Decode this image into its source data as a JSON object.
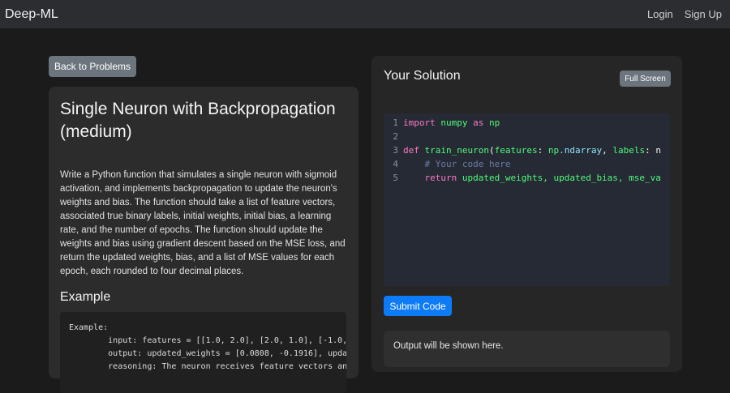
{
  "navbar": {
    "brand": "Deep-ML",
    "login": "Login",
    "signup": "Sign Up"
  },
  "left": {
    "back_button": "Back to Problems",
    "title": "Single Neuron with Backpropagation (medium)",
    "description": "Write a Python function that simulates a single neuron with sigmoid activation, and implements backpropagation to update the neuron's weights and bias. The function should take a list of feature vectors, associated true binary labels, initial weights, initial bias, a learning rate, and the number of epochs. The function should update the weights and bias using gradient descent based on the MSE loss, and return the updated weights, bias, and a list of MSE values for each epoch, each rounded to four decimal places.",
    "example_heading": "Example",
    "example_lines": [
      "Example:",
      "        input: features = [[1.0, 2.0], [2.0, 1.0], [-1.0,",
      "        output: updated_weights = [0.0808, -0.1916], upda",
      "        reasoning: The neuron receives feature vectors an"
    ]
  },
  "right": {
    "title": "Your Solution",
    "fullscreen_button": "Full Screen",
    "code": {
      "line_numbers": [
        "1",
        "2",
        "3",
        "4",
        "5"
      ],
      "line1": {
        "kw": "import",
        "mod": "numpy",
        "as": "as",
        "alias": "np"
      },
      "line3": {
        "kw": "def",
        "fn": "train_neuron",
        "open": "(",
        "p1": "features",
        "sep1": ": ",
        "t1a": "np",
        "t1b": ".ndarray",
        "comma": ", ",
        "p2": "labels",
        "sep2": ": n"
      },
      "line4": {
        "comment": "# Your code here"
      },
      "line5": {
        "kw": "return",
        "rest": "updated_weights, updated_bias, mse_va"
      }
    },
    "submit_button": "Submit Code",
    "output_placeholder": "Output will be shown here."
  }
}
